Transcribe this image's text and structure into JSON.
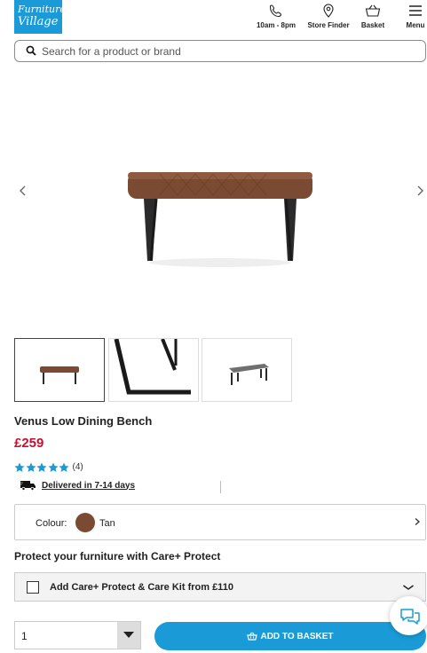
{
  "header": {
    "logo_line1": "Furniture",
    "logo_line2": "Village",
    "phone_label": "10am - 8pm",
    "store_label": "Store Finder",
    "basket_label": "Basket",
    "menu_label": "Menu"
  },
  "search": {
    "placeholder": "Search for a product or brand"
  },
  "product": {
    "title": "Venus Low Dining Bench",
    "price": "£259",
    "rating_stars": 5,
    "rating_count": "(4)",
    "delivery": "Delivered in 7-14 days"
  },
  "colour": {
    "label": "Colour:",
    "value": "Tan",
    "swatch": "#7a4a32"
  },
  "protect": {
    "title": "Protect your furniture with Care+ Protect",
    "option": "Add Care+ Protect & Care Kit from £110"
  },
  "purchase": {
    "quantity": "1",
    "add_label": "ADD TO BASKET"
  },
  "colors": {
    "brand_blue": "#1a9bd7",
    "price_red": "#c8102e",
    "star_blue": "#1a9bd7"
  }
}
